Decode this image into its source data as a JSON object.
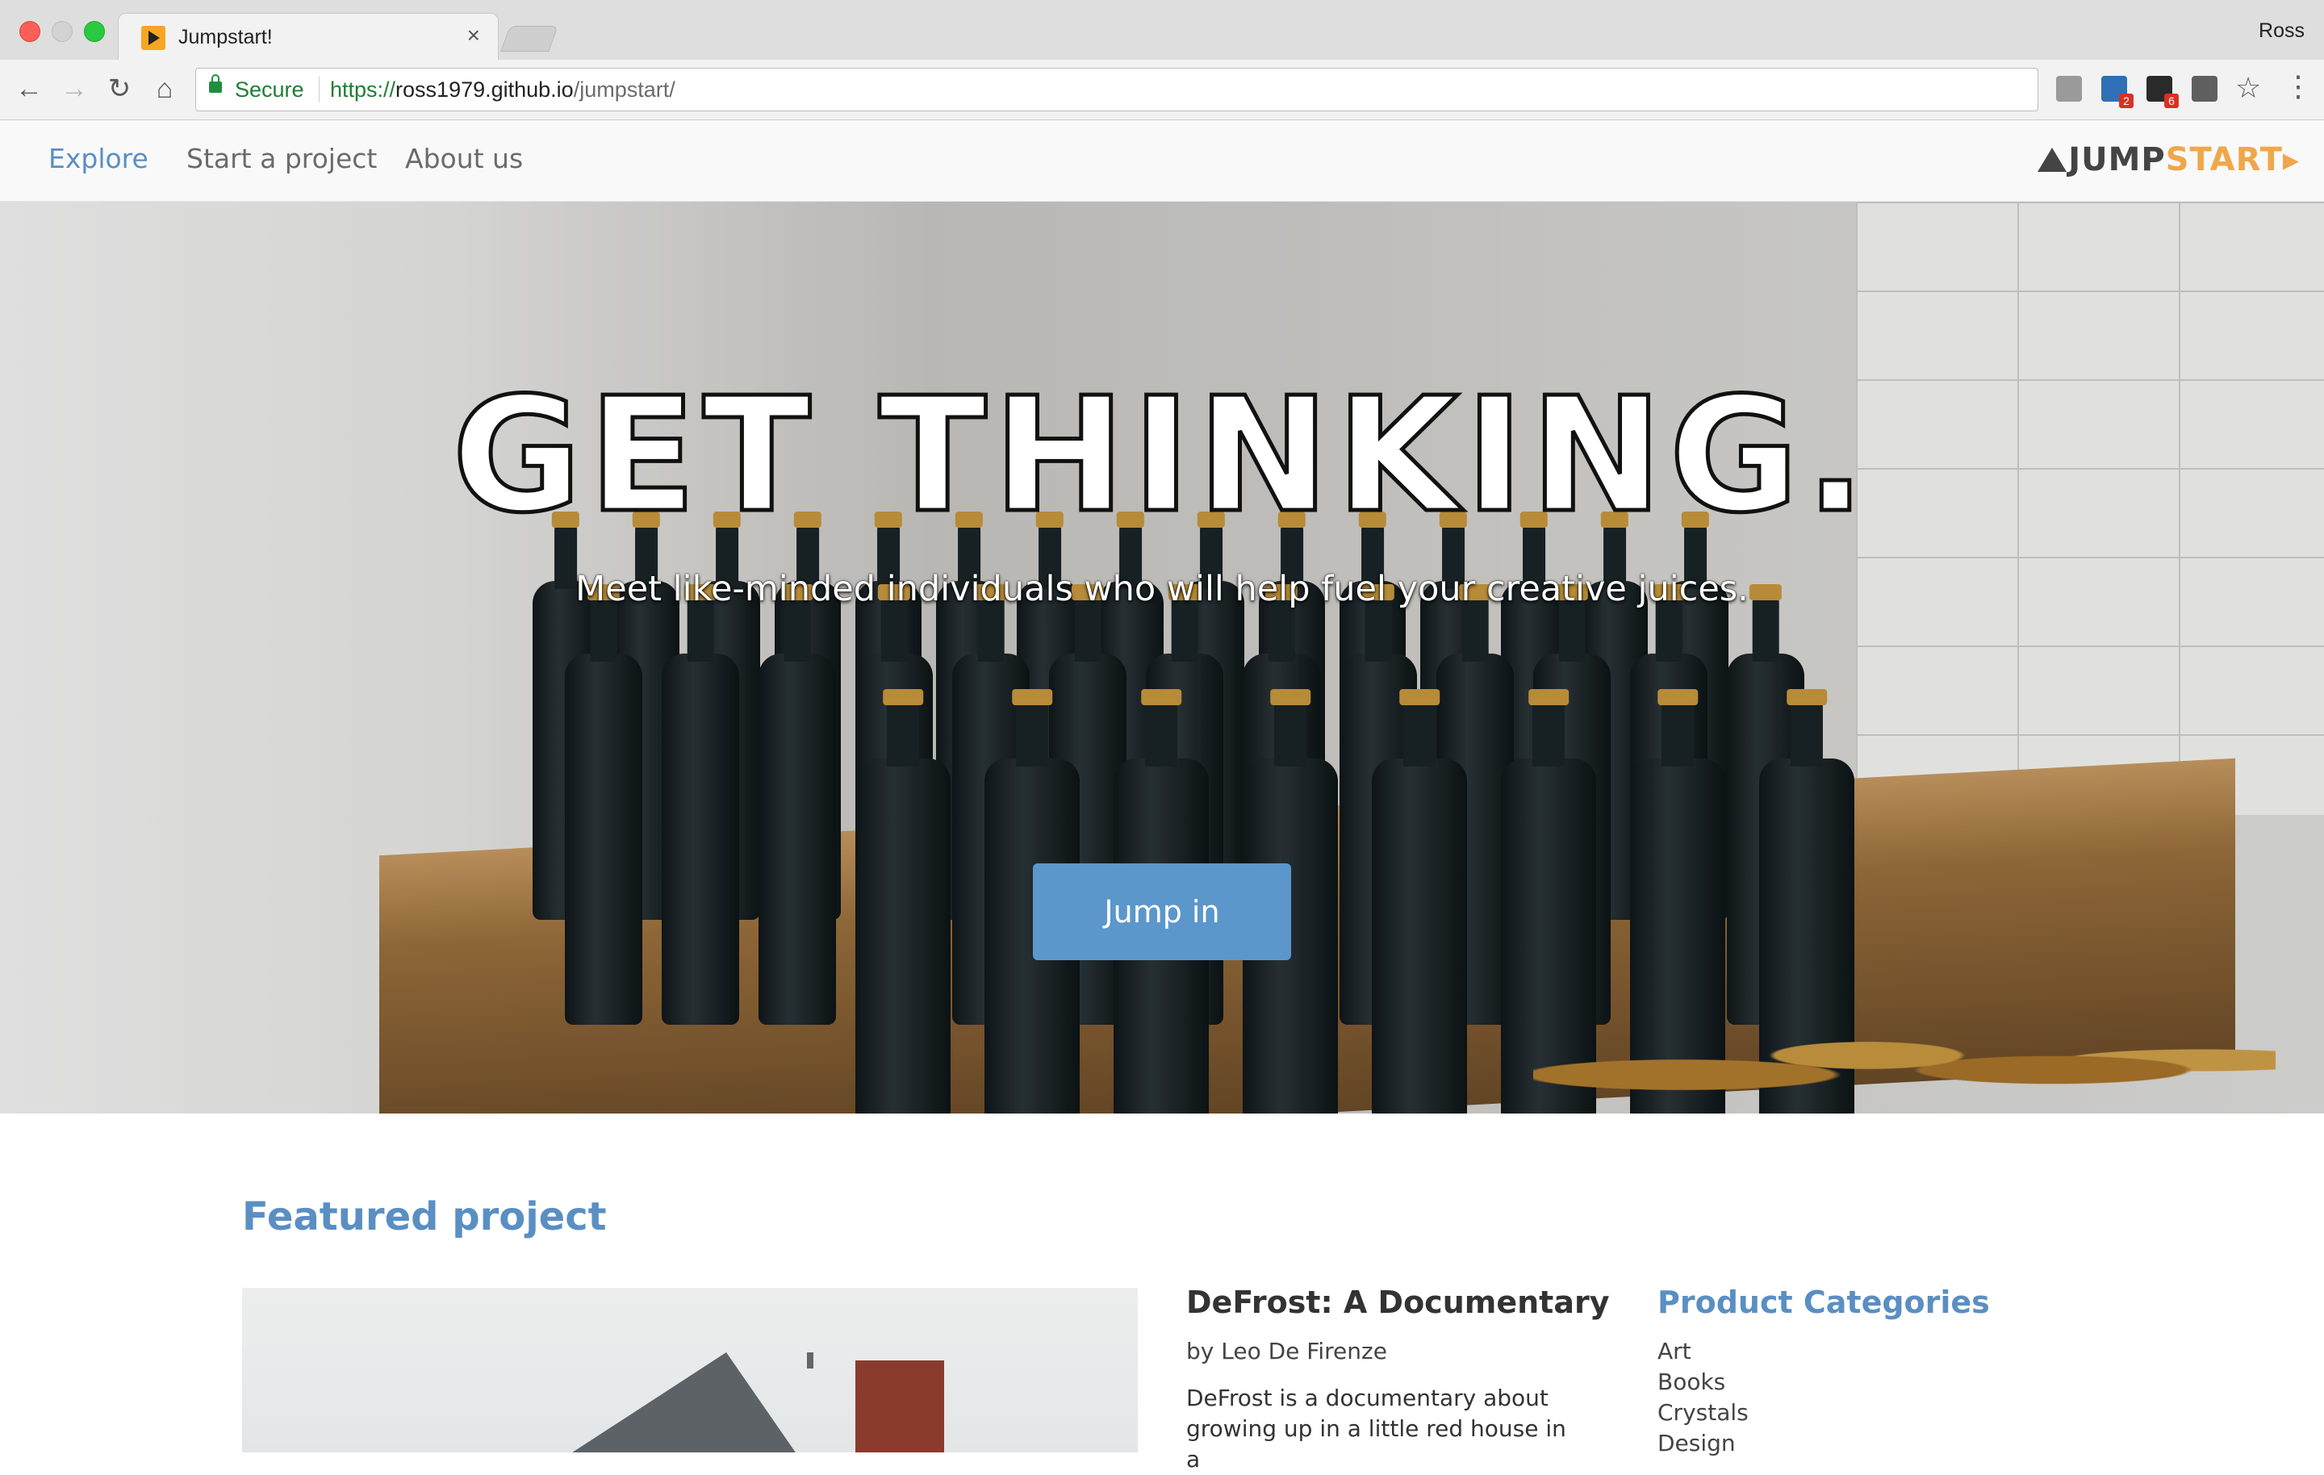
{
  "browser": {
    "tab_title": "Jumpstart!",
    "tab_close": "×",
    "profile_name": "Ross",
    "secure_label": "Secure",
    "url_scheme": "https://",
    "url_host": "ross1979.github.io",
    "url_path": "/jumpstart/",
    "extensions": [
      {
        "icon": "ext-grey-icon",
        "badge": ""
      },
      {
        "icon": "linkedin-icon",
        "badge": "2"
      },
      {
        "icon": "ext-dark-icon",
        "badge": "6"
      },
      {
        "icon": "ext-shield-icon",
        "badge": ""
      }
    ],
    "star_glyph": "☆",
    "menu_glyph": "⋮",
    "back_glyph": "←",
    "forward_glyph": "→",
    "reload_glyph": "↻",
    "home_glyph": "⌂"
  },
  "nav": {
    "links": [
      "Explore",
      "Start a project",
      "About us"
    ],
    "active": "Explore",
    "logo_jump": "JUMP",
    "logo_start": "START",
    "logo_arrow": "▸"
  },
  "hero": {
    "title": "GET THINKING.",
    "subtitle": "Meet like-minded individuals who will help fuel your creative juices.",
    "button_label": "Jump in"
  },
  "featured": {
    "section_title": "Featured project",
    "project_title": "DeFrost: A Documentary",
    "author": "by Leo De Firenze",
    "description": "DeFrost is a documentary about growing up in a little red house in a"
  },
  "categories": {
    "title": "Product Categories",
    "items": [
      "Art",
      "Books",
      "Crystals",
      "Design"
    ]
  },
  "colors": {
    "accent": "#5a8fc3",
    "button": "#5b97cb",
    "logo_orange": "#f0a74a"
  }
}
